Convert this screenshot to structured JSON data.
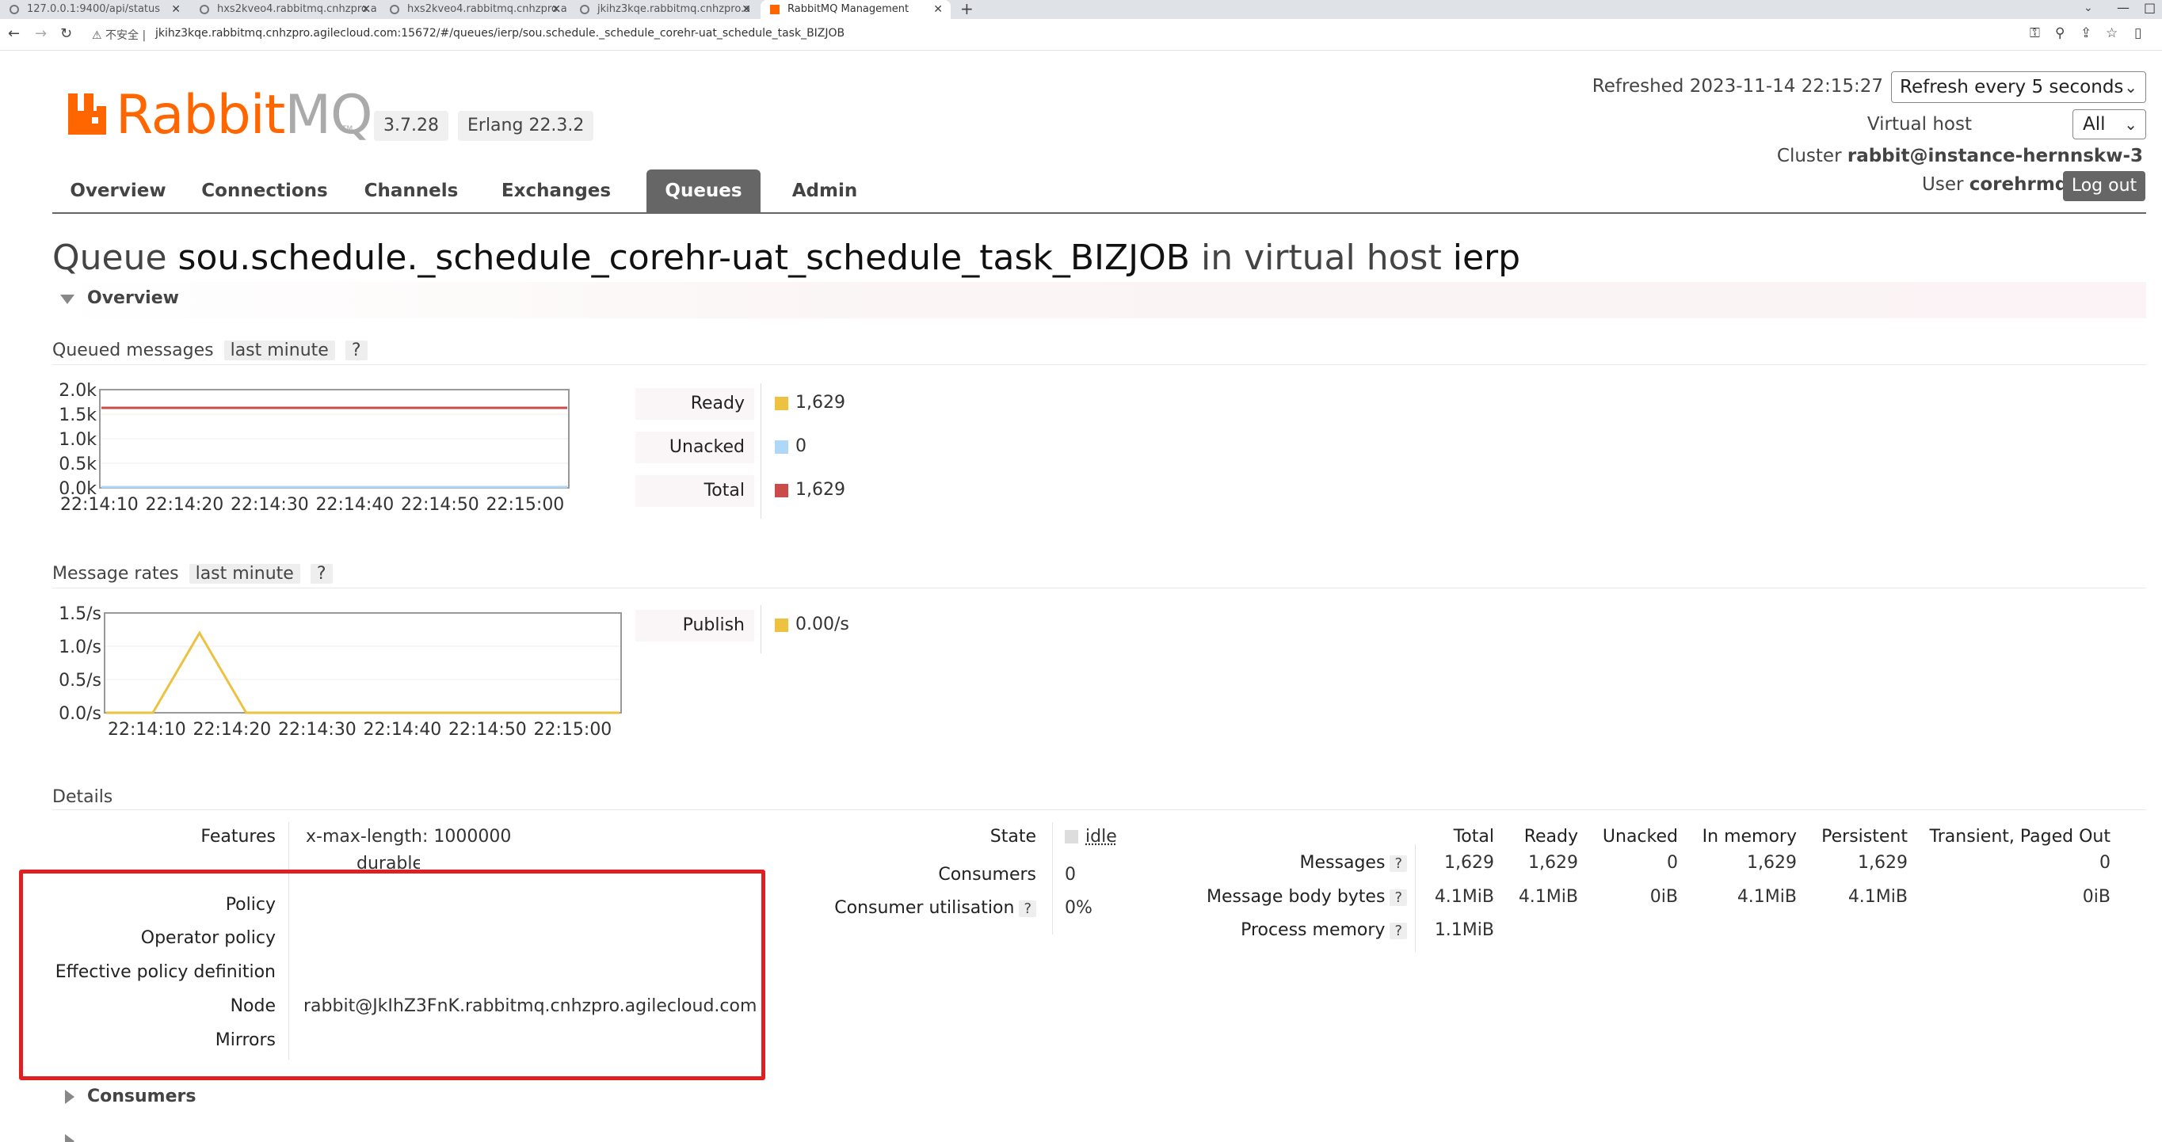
{
  "browser": {
    "tabs": [
      {
        "title": "127.0.0.1:9400/api/status"
      },
      {
        "title": "hxs2kveo4.rabbitmq.cnhzpro.a"
      },
      {
        "title": "hxs2kveo4.rabbitmq.cnhzpro.a"
      },
      {
        "title": "jkihz3kqe.rabbitmq.cnhzpro.a"
      },
      {
        "title": "RabbitMQ Management"
      }
    ],
    "security_warning": "不安全",
    "url": "jkihz3kqe.rabbitmq.cnhzpro.agilecloud.com:15672/#/queues/ierp/sou.schedule._schedule_corehr-uat_schedule_task_BIZJOB"
  },
  "header": {
    "logo_rabbit": "Rabbit",
    "logo_mq": "MQ",
    "logo_tm": "TM",
    "version": "3.7.28",
    "erlang": "Erlang 22.3.2",
    "refreshed": "Refreshed 2023-11-14 22:15:27",
    "refresh_option": "Refresh every 5 seconds",
    "vhost_label": "Virtual host",
    "vhost_value": "All",
    "cluster_label": "Cluster",
    "cluster_value": "rabbit@instance-hernnskw-3",
    "user_label": "User",
    "user_value": "corehrmq",
    "logout": "Log out"
  },
  "nav": {
    "overview": "Overview",
    "connections": "Connections",
    "channels": "Channels",
    "exchanges": "Exchanges",
    "queues": "Queues",
    "admin": "Admin"
  },
  "page": {
    "title_prefix": "Queue",
    "queue_name": "sou.schedule._schedule_corehr-uat_schedule_task_BIZJOB",
    "title_mid": "in virtual host",
    "vhost": "ierp",
    "overview_section": "Overview",
    "queued_messages_label": "Queued messages",
    "message_rates_label": "Message rates",
    "range": "last minute",
    "help": "?",
    "details_label": "Details",
    "consumers_section": "Consumers"
  },
  "chart_data": [
    {
      "type": "line",
      "title": "Queued messages",
      "x": [
        "22:14:10",
        "22:14:20",
        "22:14:30",
        "22:14:40",
        "22:14:50",
        "22:15:00"
      ],
      "y_ticks": [
        "2.0k",
        "1.5k",
        "1.0k",
        "0.5k",
        "0.0k"
      ],
      "ylim": [
        0,
        2000
      ],
      "series": [
        {
          "name": "Ready",
          "color": "#edc240",
          "values": [
            1629,
            1629,
            1629,
            1629,
            1629,
            1629
          ]
        },
        {
          "name": "Unacked",
          "color": "#afd8f8",
          "values": [
            0,
            0,
            0,
            0,
            0,
            0
          ]
        },
        {
          "name": "Total",
          "color": "#cb4b4b",
          "values": [
            1629,
            1629,
            1629,
            1629,
            1629,
            1629
          ]
        }
      ],
      "legend": [
        {
          "label": "Ready",
          "value": "1,629",
          "color": "#edc240"
        },
        {
          "label": "Unacked",
          "value": "0",
          "color": "#afd8f8"
        },
        {
          "label": "Total",
          "value": "1,629",
          "color": "#cb4b4b"
        }
      ]
    },
    {
      "type": "line",
      "title": "Message rates",
      "x": [
        "22:14:10",
        "22:14:20",
        "22:14:30",
        "22:14:40",
        "22:14:50",
        "22:15:00"
      ],
      "y_ticks": [
        "1.5/s",
        "1.0/s",
        "0.5/s",
        "0.0/s"
      ],
      "ylim": [
        0,
        1.5
      ],
      "series": [
        {
          "name": "Publish",
          "color": "#edc240",
          "points": [
            [
              0,
              0
            ],
            [
              5,
              0
            ],
            [
              10,
              1.2
            ],
            [
              15,
              0
            ],
            [
              20,
              0
            ],
            [
              30,
              0
            ],
            [
              40,
              0
            ],
            [
              50,
              0
            ],
            [
              55,
              0
            ]
          ]
        }
      ],
      "legend": [
        {
          "label": "Publish",
          "value": "0.00/s",
          "color": "#edc240"
        }
      ]
    }
  ],
  "details": {
    "features_label": "Features",
    "feature_1": "x-max-length: 1000000",
    "feature_2": "durable: true",
    "policy_label": "Policy",
    "operator_policy_label": "Operator policy",
    "effective_policy_label": "Effective policy definition",
    "node_label": "Node",
    "node_value": "rabbit@JkIhZ3FnK.rabbitmq.cnhzpro.agilecloud.com",
    "mirrors_label": "Mirrors",
    "state_label": "State",
    "state_value": "idle",
    "consumers_label": "Consumers",
    "consumers_value": "0",
    "utilisation_label": "Consumer utilisation",
    "utilisation_value": "0%",
    "table": {
      "headers": [
        "Total",
        "Ready",
        "Unacked",
        "In memory",
        "Persistent",
        "Transient, Paged Out"
      ],
      "rows": [
        {
          "label": "Messages",
          "values": [
            "1,629",
            "1,629",
            "0",
            "1,629",
            "1,629",
            "0"
          ]
        },
        {
          "label": "Message body bytes",
          "values": [
            "4.1MiB",
            "4.1MiB",
            "0iB",
            "4.1MiB",
            "4.1MiB",
            "0iB"
          ]
        },
        {
          "label": "Process memory",
          "values": [
            "1.1MiB"
          ]
        }
      ]
    }
  }
}
